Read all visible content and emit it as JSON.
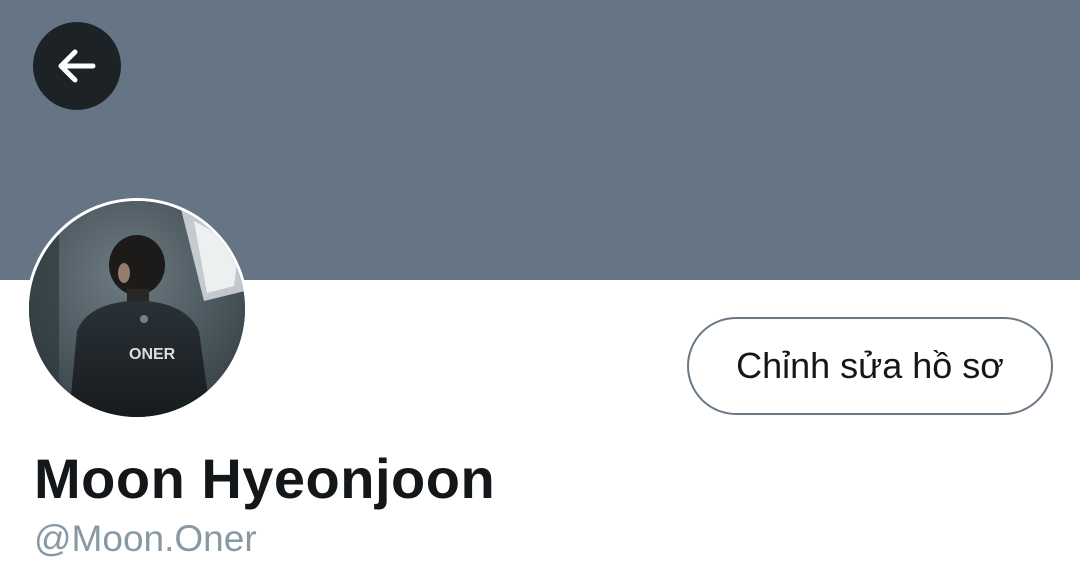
{
  "header": {
    "banner_color": "#667586",
    "back_icon": "arrow-left-icon"
  },
  "profile": {
    "avatar": {
      "description_icon": "profile-photo",
      "jersey_text": "ONER"
    },
    "edit_button_label": "Chỉnh sửa hồ sơ",
    "display_name": "Moon Hyeonjoon",
    "handle": "@Moon.Oner"
  },
  "colors": {
    "text_primary": "#14171a",
    "text_secondary": "#8899a6",
    "button_border": "#6a7884"
  }
}
